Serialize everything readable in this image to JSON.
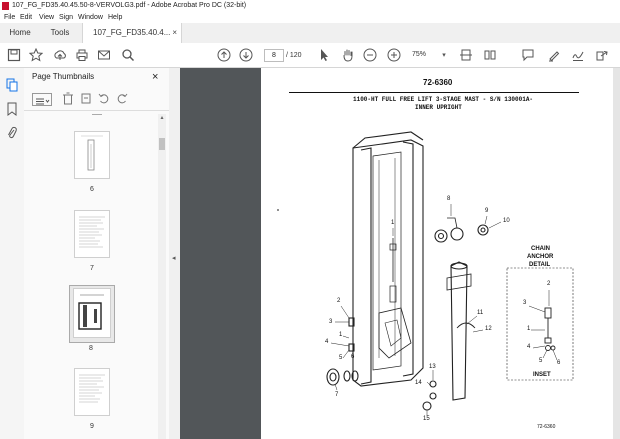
{
  "window": {
    "title": "107_FG_FD35.40.45.50-8-VERVOLG3.pdf - Adobe Acrobat Pro DC (32-bit)"
  },
  "menu": [
    "File",
    "Edit",
    "View",
    "Sign",
    "Window",
    "Help"
  ],
  "tabs": {
    "home": "Home",
    "tools": "Tools",
    "doc": "107_FG_FD35.40.4...",
    "close": "×"
  },
  "toolbar": {
    "page_current": "8",
    "page_total": "/ 120",
    "zoom": "75%"
  },
  "thumbnails": {
    "header": "Page Thumbnails",
    "close": "×",
    "pages": [
      "6",
      "7",
      "8",
      "9"
    ],
    "selected": "8"
  },
  "document": {
    "part_number": "72-6360",
    "heading_line1": "1100-HT FULL FREE LIFT 3-STAGE MAST - S/N 130001A-",
    "heading_line2": "INNER UPRIGHT",
    "inset_title_1": "CHAIN",
    "inset_title_2": "ANCHOR",
    "inset_title_3": "DETAIL",
    "inset_label": "INSET",
    "footer_code": "72-6360",
    "callouts": [
      "1",
      "2",
      "3",
      "1",
      "4",
      "5",
      "6",
      "7",
      "8",
      "9",
      "10",
      "11",
      "12",
      "13",
      "14",
      "15",
      "1",
      "2",
      "3",
      "4",
      "5",
      "6"
    ]
  },
  "colors": {
    "accent_pdf": "#c8102e",
    "doc_bg": "#525659"
  }
}
